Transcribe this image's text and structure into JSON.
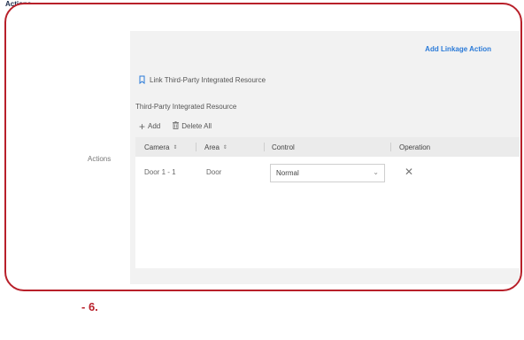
{
  "section": {
    "top_label": "Actions"
  },
  "form": {
    "left_label": "Actions",
    "add_linkage_action": "Add Linkage Action",
    "link_resource_label": "Link Third-Party Integrated Resource",
    "resource_section_title": "Third-Party Integrated Resource",
    "toolbar": {
      "add_label": "Add",
      "delete_all_label": "Delete All"
    },
    "table": {
      "headers": [
        "Camera",
        "Area",
        "Control",
        "Operation"
      ],
      "rows": [
        {
          "camera": "Door 1 - 1",
          "area": "Door",
          "control": "Normal"
        }
      ]
    }
  },
  "step_marker": "-  6.",
  "colors": {
    "accent_red": "#b8202a",
    "link_blue": "#2a7ad8"
  },
  "icons": [
    "bookmark-icon",
    "plus-icon",
    "trash-icon",
    "chevron-down-icon",
    "close-icon",
    "sort-icon"
  ]
}
